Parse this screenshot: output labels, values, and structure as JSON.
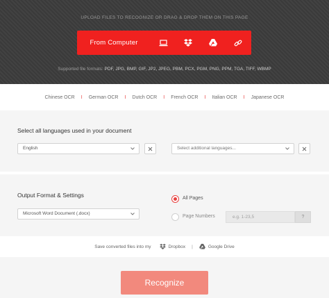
{
  "upload": {
    "hint": "UPLOAD FILES TO RECOGNIZE OR DRAG & DROP THEM ON THIS PAGE",
    "from_computer_label": "From Computer",
    "sources": [
      "laptop-icon",
      "dropbox-icon",
      "google-drive-icon",
      "link-icon"
    ],
    "formats_label": "Supported file formats:",
    "formats": "PDF, JPG, BMP, GIF, JP2, JPEG, PBM, PCX, PGM, PNG, PPM, TGA, TIFF, WBMP",
    "accent_color": "#f0211f"
  },
  "ocr_links": [
    "Chinese OCR",
    "German OCR",
    "Dutch OCR",
    "French OCR",
    "Italian OCR",
    "Japanese OCR"
  ],
  "languages": {
    "title": "Select all languages used in your document",
    "primary_value": "English",
    "additional_placeholder": "Select additional languages..."
  },
  "output": {
    "title": "Output Format & Settings",
    "format_value": "Microsoft Word Document (.docx)",
    "all_pages_label": "All Pages",
    "page_numbers_label": "Page Numbers",
    "page_numbers_placeholder": "e.g. 1-23,5",
    "help_label": "?",
    "selected": "All Pages"
  },
  "save": {
    "label": "Save converted files into my",
    "dropbox_label": "Dropbox",
    "separator": "|",
    "google_drive_label": "Google Drive"
  },
  "recognize": {
    "label": "Recognize",
    "color": "#f2897d"
  }
}
